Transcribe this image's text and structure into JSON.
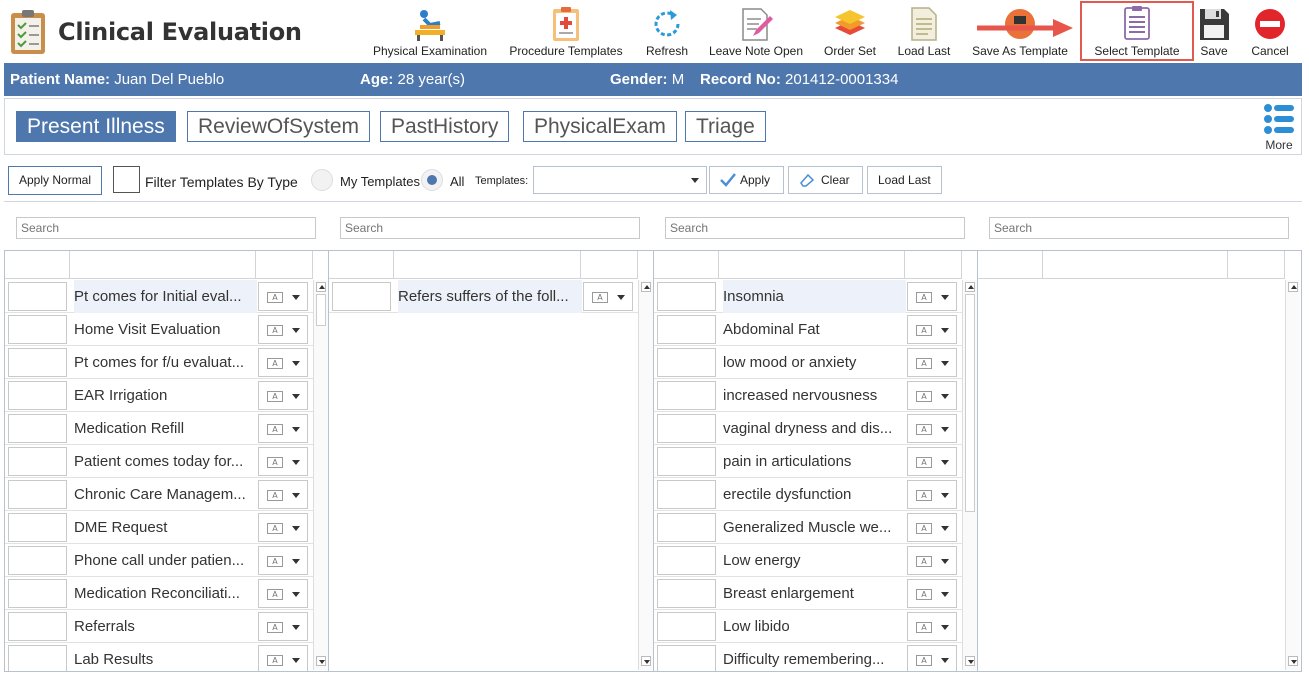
{
  "app": {
    "title": "Clinical Evaluation",
    "icon": "clipboard-checklist-icon"
  },
  "toolbar": [
    {
      "label": "Physical Examination",
      "icon": "physical-exam-icon"
    },
    {
      "label": "Procedure Templates",
      "icon": "procedure-clipboard-icon"
    },
    {
      "label": "Refresh",
      "icon": "refresh-icon"
    },
    {
      "label": "Leave Note Open",
      "icon": "note-pencil-icon"
    },
    {
      "label": "Order Set",
      "icon": "layers-icon"
    },
    {
      "label": "Load Last",
      "icon": "document-icon"
    },
    {
      "label": "Save As Template",
      "icon": "save-as-template-icon"
    },
    {
      "label": "Select Template",
      "icon": "template-list-icon",
      "highlighted": true
    },
    {
      "label": "Save",
      "icon": "floppy-disk-icon"
    },
    {
      "label": "Cancel",
      "icon": "cancel-icon"
    }
  ],
  "patient": {
    "name_label": "Patient Name:",
    "name": "Juan Del Pueblo",
    "age_label": "Age:",
    "age": "28 year(s)",
    "gender_label": "Gender:",
    "gender": "M",
    "record_label": "Record No:",
    "record": "201412-0001334"
  },
  "tabs": [
    "Present Illness",
    "ReviewOfSystem",
    "PastHistory",
    "PhysicalExam",
    "Triage"
  ],
  "more_label": "More",
  "filter": {
    "apply_normal": "Apply Normal",
    "filter_by_type": "Filter Templates By Type",
    "my_templates": "My Templates",
    "all": "All",
    "templates_label": "Templates:",
    "templates_value": "",
    "apply": "Apply",
    "clear": "Clear",
    "load_last": "Load Last"
  },
  "search_placeholder": "Search",
  "columns": [
    {
      "items": [
        "Pt comes for Initial eval...",
        "Home Visit Evaluation",
        "Pt comes for f/u evaluat...",
        "EAR Irrigation",
        "Medication Refill",
        "Patient comes today for...",
        "Chronic Care Managem...",
        "DME Request",
        "Phone call under patien...",
        "Medication Reconciliati...",
        "Referrals",
        "Lab Results"
      ],
      "selected": 0
    },
    {
      "items": [
        "Refers suffers of the foll..."
      ],
      "selected": 0
    },
    {
      "items": [
        "Insomnia",
        "Abdominal Fat",
        "low mood or anxiety",
        "increased nervousness",
        "vaginal dryness and dis...",
        "pain in articulations",
        "erectile dysfunction",
        "Generalized Muscle we...",
        "Low energy",
        "Breast enlargement",
        "Low libido",
        "Difficulty remembering..."
      ],
      "selected": 0
    },
    {
      "items": [],
      "selected": -1
    }
  ],
  "colors": {
    "accent": "#4e77ad",
    "highlight_border": "#e05a50",
    "arrow": "#e8554a"
  }
}
